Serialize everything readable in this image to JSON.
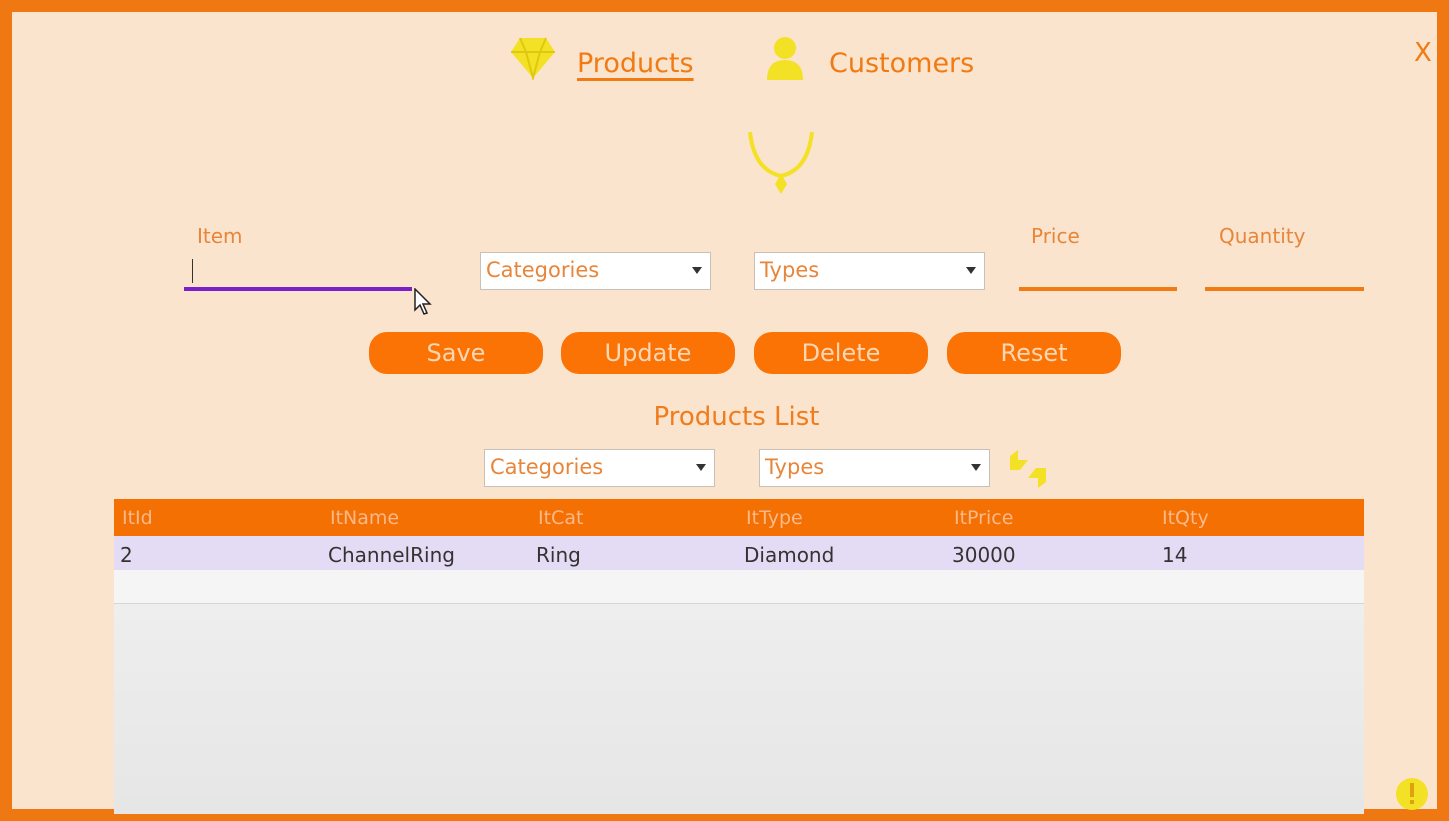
{
  "nav": {
    "products": "Products",
    "customers": "Customers",
    "close": "X"
  },
  "form": {
    "item_label": "Item",
    "item_value": "",
    "categories_select": "Categories",
    "types_select": "Types",
    "price_label": "Price",
    "quantity_label": "Quantity"
  },
  "buttons": {
    "save": "Save",
    "update": "Update",
    "delete": "Delete",
    "reset": "Reset"
  },
  "list": {
    "title": "Products List",
    "filter_categories": "Categories",
    "filter_types": "Types",
    "columns": [
      "ItId",
      "ItName",
      "ItCat",
      "ItType",
      "ItPrice",
      "ItQty"
    ],
    "rows": [
      [
        "2",
        "ChannelRing",
        "Ring",
        "Diamond",
        "30000",
        "14"
      ]
    ]
  },
  "colors": {
    "accent": "#f07813",
    "background": "#fbe4cd",
    "icon_yellow": "#f2e125",
    "selection": "#7b1fc8"
  }
}
